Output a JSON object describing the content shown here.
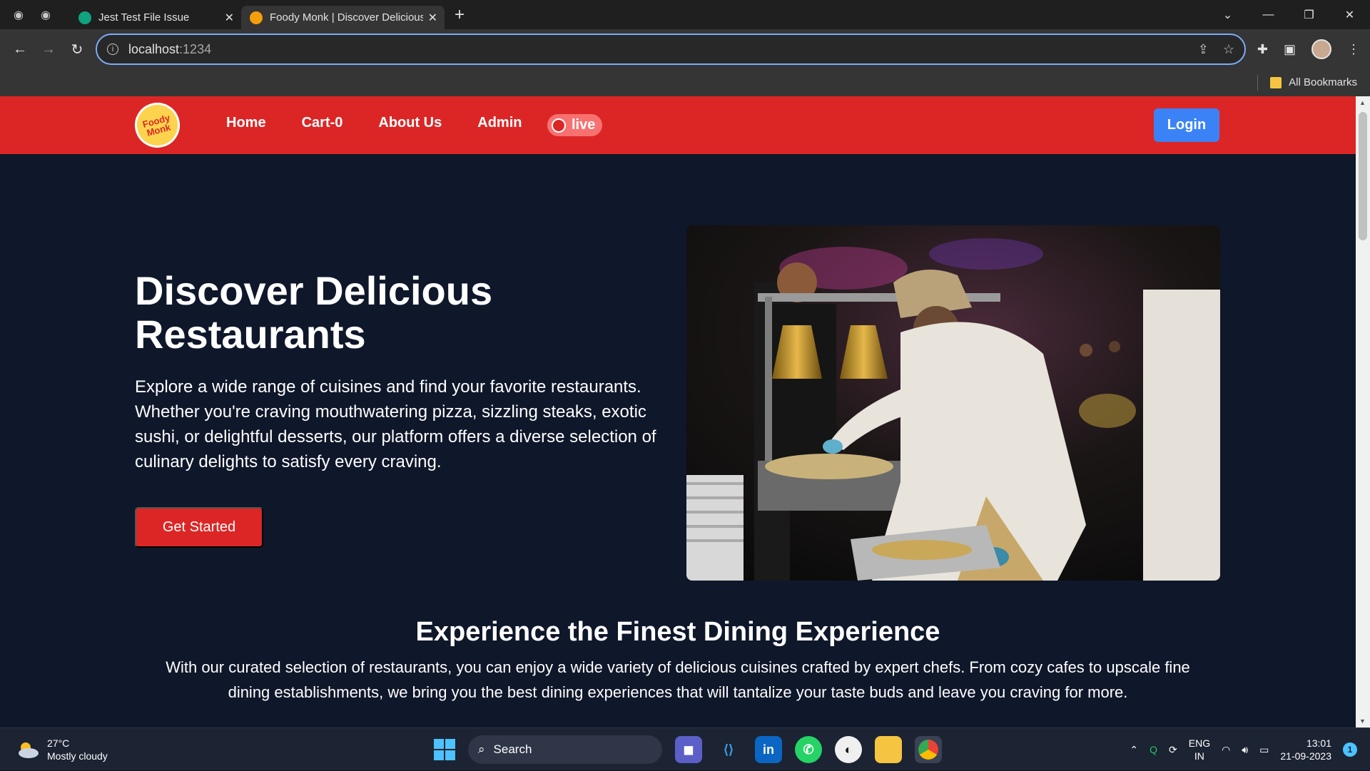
{
  "browser": {
    "tabs": [
      {
        "title": "Jest Test File Issue",
        "active": false
      },
      {
        "title": "Foody Monk | Discover Delicious",
        "active": true
      }
    ],
    "url_host": "localhost",
    "url_port": ":1234",
    "bookmarks_label": "All Bookmarks"
  },
  "site": {
    "logo_text_1": "Foody",
    "logo_text_2": "Monk",
    "nav": {
      "home": "Home",
      "cart": "Cart-0",
      "about": "About Us",
      "admin": "Admin",
      "live": "live",
      "login": "Login"
    },
    "hero": {
      "title": "Discover Delicious Restaurants",
      "text": "Explore a wide range of cuisines and find your favorite restaurants. Whether you're craving mouthwatering pizza, sizzling steaks, exotic sushi, or delightful desserts, our platform offers a diverse selection of culinary delights to satisfy every craving.",
      "cta": "Get Started"
    },
    "section": {
      "title": "Experience the Finest Dining Experience",
      "text": "With our curated selection of restaurants, you can enjoy a wide variety of delicious cuisines crafted by expert chefs. From cozy cafes to upscale fine dining establishments, we bring you the best dining experiences that will tantalize your taste buds and leave you craving for more."
    }
  },
  "taskbar": {
    "temp": "27°C",
    "weather": "Mostly cloudy",
    "search": "Search",
    "lang1": "ENG",
    "lang2": "IN",
    "time": "13:01",
    "date": "21-09-2023",
    "notifications": "1"
  },
  "colors": {
    "nav_red": "#dc2626",
    "login_blue": "#3b82f6",
    "page_bg": "#0f172a"
  }
}
